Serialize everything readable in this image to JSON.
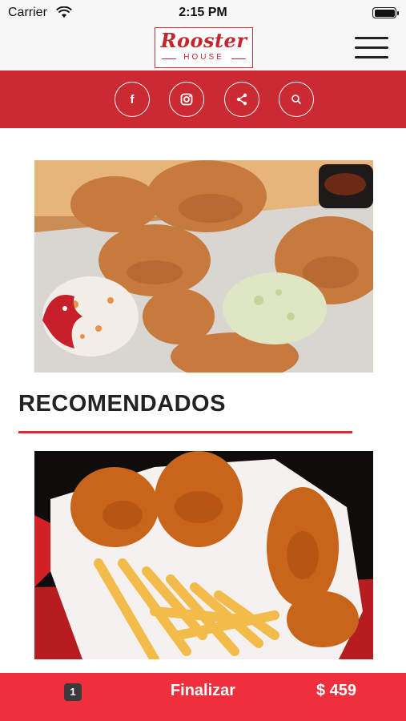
{
  "status_bar": {
    "carrier": "Carrier",
    "time": "2:15 PM"
  },
  "header": {
    "logo_text": "Rooster",
    "logo_subtext": "HOUSE"
  },
  "social": {
    "items": [
      {
        "name": "facebook",
        "glyph": "f"
      },
      {
        "name": "instagram"
      },
      {
        "name": "share"
      },
      {
        "name": "search"
      }
    ]
  },
  "main": {
    "section_title": "RECOMENDADOS"
  },
  "footer": {
    "cart_count": "1",
    "finalize_label": "Finalizar",
    "total": "$ 459"
  },
  "colors": {
    "brand_red": "#cc2a33",
    "cart_bar": "#ee2f3c",
    "accent_rule": "#e0262f"
  }
}
